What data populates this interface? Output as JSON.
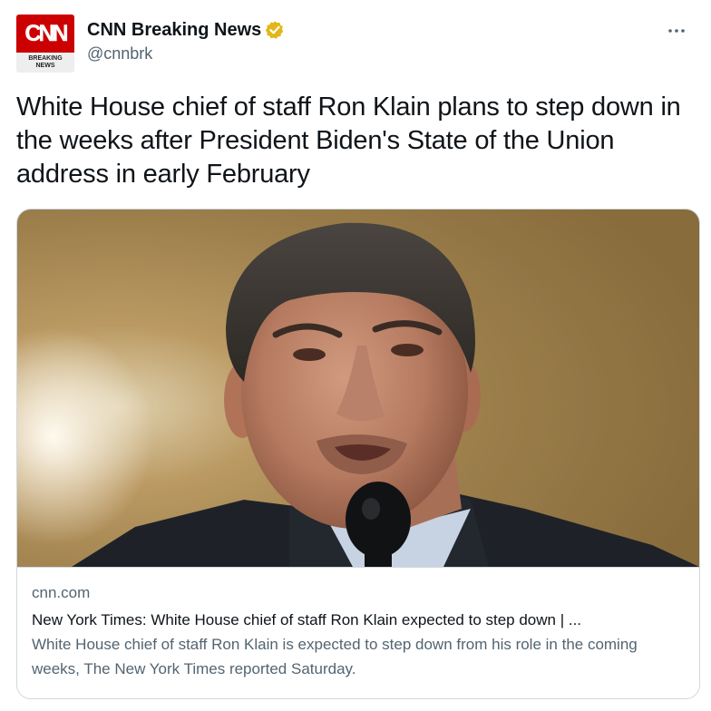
{
  "author": {
    "display_name": "CNN Breaking News",
    "handle": "@cnnbrk",
    "verified": true,
    "avatar": {
      "logo_text": "CNN",
      "subtitle_line1": "BREAKING",
      "subtitle_line2": "NEWS",
      "brand_color": "#cc0000"
    }
  },
  "tweet": {
    "text": "White House chief of staff Ron Klain plans to step down in the weeks after President Biden's State of the Union address in early February"
  },
  "card": {
    "domain": "cnn.com",
    "title": "New York Times: White House chief of staff Ron Klain expected to step down | ...",
    "description": "White House chief of staff Ron Klain is expected to step down from his role in the coming weeks, The New York Times reported Saturday."
  },
  "colors": {
    "text_primary": "#0f1419",
    "text_secondary": "#536471",
    "border": "#cfd9de",
    "verified_badge": "#e2b719"
  },
  "icons": {
    "verified": "verified-badge-icon",
    "more": "more-dots-icon"
  }
}
